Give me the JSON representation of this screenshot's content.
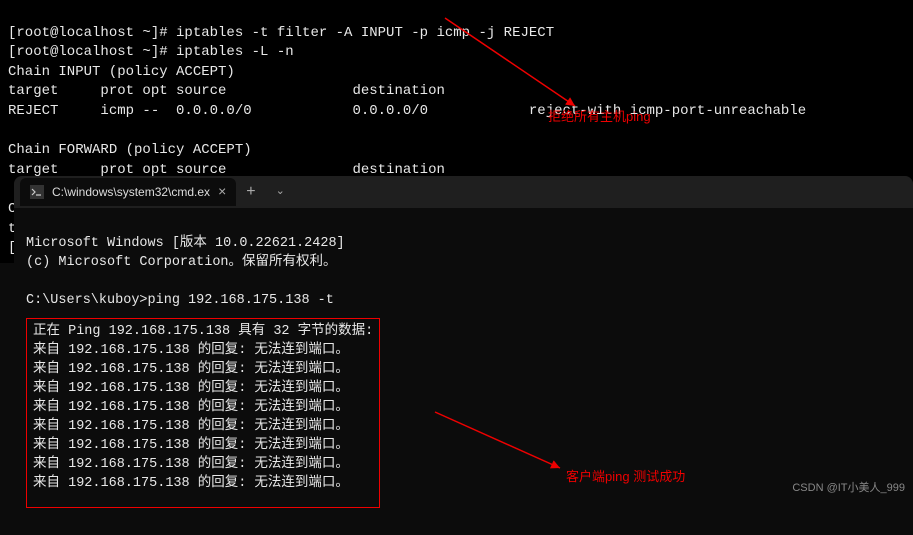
{
  "linux": {
    "line1": "[root@localhost ~]# iptables -t filter -A INPUT -p icmp -j REJECT",
    "line2": "[root@localhost ~]# iptables -L -n",
    "line3": "Chain INPUT (policy ACCEPT)",
    "line4": "target     prot opt source               destination",
    "line5": "REJECT     icmp --  0.0.0.0/0            0.0.0.0/0            reject-with icmp-port-unreachable",
    "line6": "",
    "line7": "Chain FORWARD (policy ACCEPT)",
    "line8": "target     prot opt source               destination",
    "line9": "",
    "line10": "Chain OUTPUT (policy ACCEPT)",
    "line11": "ta",
    "line12": "["
  },
  "cmd": {
    "tab_title": "C:\\windows\\system32\\cmd.ex",
    "header1": "Microsoft Windows [版本 10.0.22621.2428]",
    "header2": "(c) Microsoft Corporation。保留所有权利。",
    "prompt": "C:\\Users\\kuboy>ping 192.168.175.138 -t",
    "ping_header": "正在 Ping 192.168.175.138 具有 32 字节的数据:",
    "ping_lines": [
      "来自 192.168.175.138 的回复: 无法连到端口。",
      "来自 192.168.175.138 的回复: 无法连到端口。",
      "来自 192.168.175.138 的回复: 无法连到端口。",
      "来自 192.168.175.138 的回复: 无法连到端口。",
      "来自 192.168.175.138 的回复: 无法连到端口。",
      "来自 192.168.175.138 的回复: 无法连到端口。",
      "来自 192.168.175.138 的回复: 无法连到端口。",
      "来自 192.168.175.138 的回复: 无法连到端口。"
    ]
  },
  "annotations": {
    "top": "拒绝所有主机ping",
    "bottom": "客户端ping 测试成功"
  },
  "watermark": "CSDN @IT小美人_999"
}
